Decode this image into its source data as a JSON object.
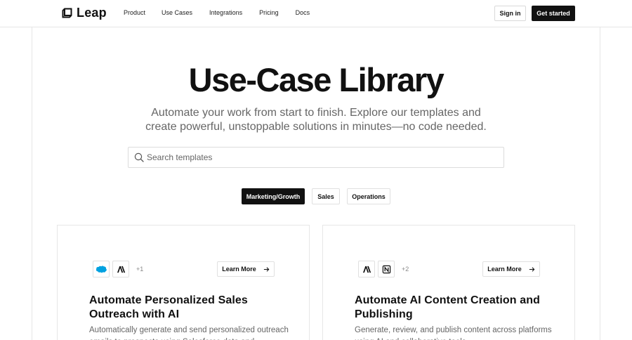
{
  "header": {
    "logo_text": "Leap",
    "nav": [
      "Product",
      "Use Cases",
      "Integrations",
      "Pricing",
      "Docs"
    ],
    "sign_in": "Sign in",
    "get_started": "Get started"
  },
  "hero": {
    "title": "Use-Case Library",
    "subtitle": "Automate your work from start to finish. Explore our templates and create powerful, unstoppable solutions in minutes—no code needed."
  },
  "search": {
    "placeholder": "Search templates",
    "value": ""
  },
  "filters": [
    {
      "label": "Marketing/Growth",
      "active": true
    },
    {
      "label": "Sales",
      "active": false
    },
    {
      "label": "Operations",
      "active": false
    }
  ],
  "cards": [
    {
      "icons": [
        "salesforce-icon",
        "anthropic-icon"
      ],
      "more": "+1",
      "learn_more": "Learn More",
      "title": "Automate Personalized Sales Outreach with AI",
      "description": "Automatically generate and send personalized outreach emails to prospects using Salesforce data and"
    },
    {
      "icons": [
        "anthropic-icon",
        "notion-icon"
      ],
      "more": "+2",
      "learn_more": "Learn More",
      "title": "Automate AI Content Creation and Publishing",
      "description": "Generate, review, and publish content across platforms using AI and collaborative tools."
    }
  ],
  "colors": {
    "primary": "#111111",
    "border": "#e6e6e6",
    "muted_text": "#666666",
    "salesforce": "#00a1e0"
  }
}
